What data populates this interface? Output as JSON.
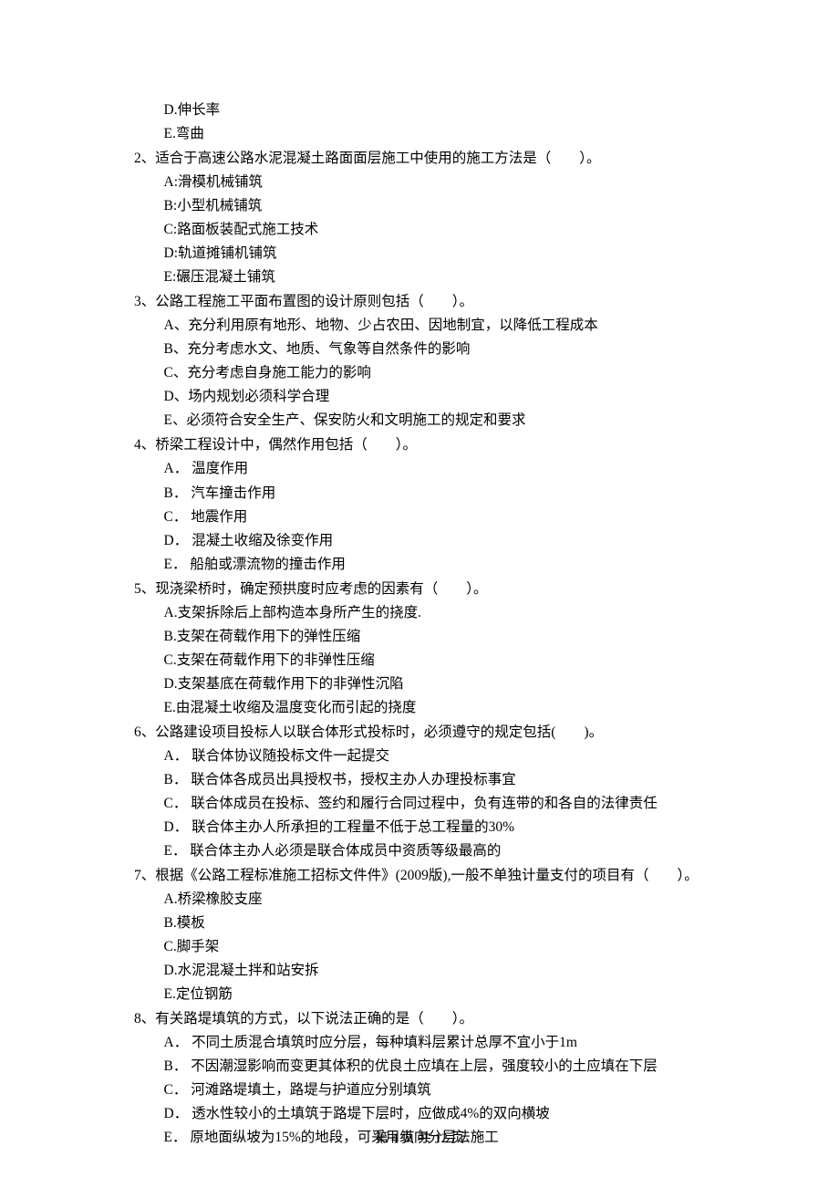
{
  "carryoverOptions": [
    "D.伸长率",
    "E.弯曲"
  ],
  "questions": [
    {
      "num": "2、",
      "stem": "适合于高速公路水泥混凝土路面面层施工中使用的施工方法是（　　）。",
      "options": [
        "A:滑模机械铺筑",
        "B:小型机械铺筑",
        "C:路面板装配式施工技术",
        "D:轨道摊铺机铺筑",
        "E:碾压混凝土铺筑"
      ]
    },
    {
      "num": "3、",
      "stem": "公路工程施工平面布置图的设计原则包括（　　）。",
      "options": [
        "A、充分利用原有地形、地物、少占农田、因地制宜，以降低工程成本",
        "B、充分考虑水文、地质、气象等自然条件的影响",
        "C、充分考虑自身施工能力的影响",
        "D、场内规划必须科学合理",
        "E、必须符合安全生产、保安防火和文明施工的规定和要求"
      ]
    },
    {
      "num": "4、",
      "stem": "桥梁工程设计中，偶然作用包括（　　）。",
      "options": [
        "A． 温度作用",
        "B． 汽车撞击作用",
        "C． 地震作用",
        "D． 混凝土收缩及徐变作用",
        "E． 船舶或漂流物的撞击作用"
      ]
    },
    {
      "num": "5、",
      "stem": "现浇梁桥时，确定预拱度时应考虑的因素有（　　）。",
      "options": [
        "A.支架拆除后上部构造本身所产生的挠度.",
        "B.支架在荷载作用下的弹性压缩",
        "C.支架在荷载作用下的非弹性压缩",
        "D.支架基底在荷载作用下的非弹性沉陷",
        "E.由混凝土收缩及温度变化而引起的挠度"
      ]
    },
    {
      "num": "6、",
      "stem": "公路建设项目投标人以联合体形式投标时，必须遵守的规定包括(　　)。",
      "options": [
        "A． 联合体协议随投标文件一起提交",
        "B． 联合体各成员出具授权书，授权主办人办理投标事宜",
        "C． 联合体成员在投标、签约和履行合同过程中，负有连带的和各自的法律责任",
        "D． 联合体主办人所承担的工程量不低于总工程量的30%",
        "E． 联合体主办人必须是联合体成员中资质等级最高的"
      ]
    },
    {
      "num": "7、",
      "stem": "根据《公路工程标准施工招标文件件》(2009版),一般不单独计量支付的项目有（　　）。",
      "options": [
        "A.桥梁橡胶支座",
        "B.模板",
        "C.脚手架",
        "D.水泥混凝土拌和站安拆",
        "E.定位钢筋"
      ]
    },
    {
      "num": "8、",
      "stem": "有关路堤填筑的方式，以下说法正确的是（　　）。",
      "options": [
        "A． 不同土质混合填筑时应分层，每种填料层累计总厚不宜小于1m",
        "B． 不因潮湿影响而变更其体积的优良土应填在上层，强度较小的土应填在下层",
        "C． 河滩路堤填土，路堤与护道应分别填筑",
        "D． 透水性较小的土填筑于路堤下层时，应做成4%的双向横坡",
        "E． 原地面纵坡为15%的地段，可采用纵向分层法施工"
      ]
    }
  ],
  "footer": {
    "prefix": "第 ",
    "current": "4",
    "middle": " 页 共 ",
    "total": "12",
    "suffix": " 页"
  }
}
